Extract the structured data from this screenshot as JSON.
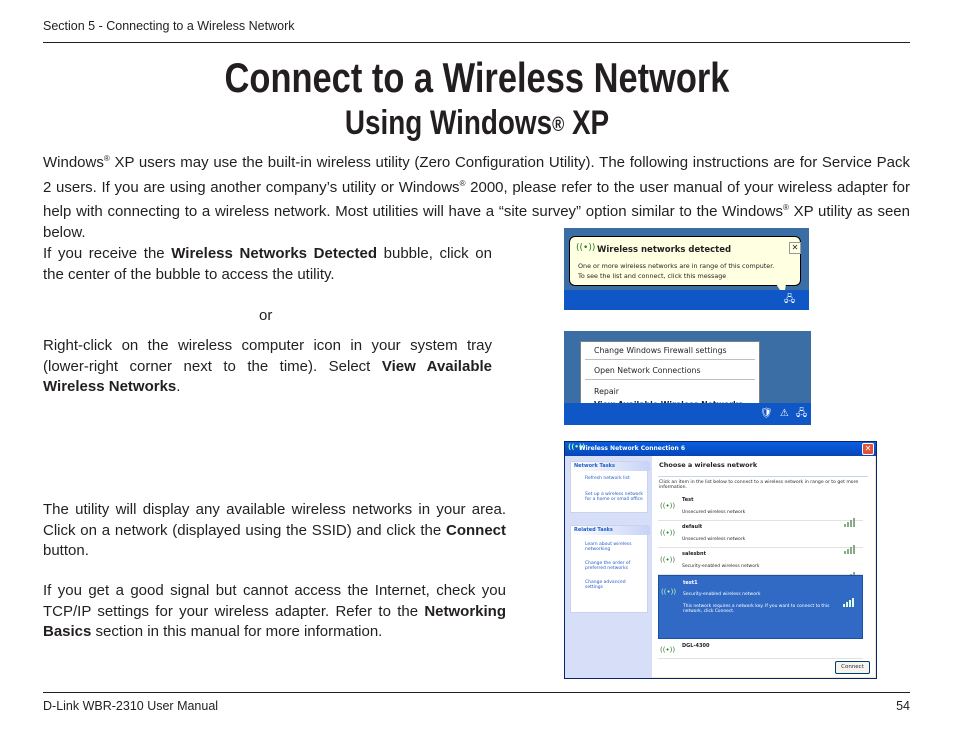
{
  "header": {
    "section": "Section 5 - Connecting to a Wireless Network"
  },
  "title": {
    "line1": "Connect to a Wireless Network",
    "line2_prefix": "Using Windows",
    "line2_reg": "®",
    "line2_suffix": " XP"
  },
  "intro": {
    "s1": "Windows",
    "reg": "®",
    "s2": " XP users may use the built-in wireless utility (Zero Configuration Utility). The following instructions are for Service Pack 2 users.  If you are using another company’s utility or Windows",
    "s3": " 2000, please refer to the user manual of your wireless adapter for help with connecting to a wireless network. Most utilities will have a “site survey” option similar to the Windows",
    "s4": " XP utility as seen below."
  },
  "step1": {
    "a": "If you receive the ",
    "bold": "Wireless Networks Detected",
    "b": " bubble, click on the center of the bubble to access the utility."
  },
  "or": "or",
  "step2": {
    "a": "Right-click on the wireless computer icon in your system tray (lower-right corner next to the time). Select ",
    "bold": "View Available Wireless Networks",
    "b": "."
  },
  "step3": {
    "a": "The utility will display any available wireless networks in your area. Click on a network (displayed using the SSID) and click the ",
    "bold": "Connect",
    "b": " button."
  },
  "step4": {
    "a": "If you get a good signal but cannot access the Internet, check you TCP/IP settings for your wireless adapter. Refer to the ",
    "bold": "Networking Basics",
    "b": " section in this manual for more information."
  },
  "shot1": {
    "title": "Wireless networks detected",
    "body1": "One or more wireless networks are in range of this computer.",
    "body2": "To see the list and connect, click this message",
    "close": "✕"
  },
  "shot2": {
    "menu": [
      "Change Windows Firewall settings",
      "Open Network Connections",
      "Repair",
      "View Available Wireless Networks"
    ]
  },
  "shot3": {
    "window_title": "Wireless Network Connection 6",
    "network_tasks_head": "Network Tasks",
    "network_tasks": [
      "Refresh network list",
      "Set up a wireless network for a home or small office"
    ],
    "related_tasks_head": "Related Tasks",
    "related_tasks": [
      "Learn about wireless networking",
      "Change the order of preferred networks",
      "Change advanced settings"
    ],
    "heading": "Choose a wireless network",
    "instructions": "Click an item in the list below to connect to a wireless network in range or to get more information.",
    "networks": [
      {
        "ssid": "Test",
        "status": "Unsecured wireless network"
      },
      {
        "ssid": "default",
        "status": "Unsecured wireless network"
      },
      {
        "ssid": "salesbnt",
        "status": "Security-enabled wireless network"
      },
      {
        "ssid": "test1",
        "status": "Security-enabled wireless network",
        "detail": "This network requires a network key. If you want to connect to this network, click Connect."
      },
      {
        "ssid": "DGL-4300",
        "status": ""
      }
    ],
    "connect": "Connect"
  },
  "footer": {
    "left": "D-Link WBR-2310 User Manual",
    "page": "54"
  }
}
